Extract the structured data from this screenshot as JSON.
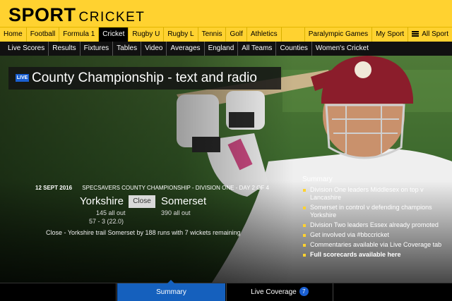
{
  "brand": {
    "sport": "SPORT",
    "section": "CRICKET"
  },
  "nav_primary": [
    "Home",
    "Football",
    "Formula 1",
    "Cricket",
    "Rugby U",
    "Rugby L",
    "Tennis",
    "Golf",
    "Athletics"
  ],
  "nav_primary_active": "Cricket",
  "nav_primary_right": [
    "Paralympic Games",
    "My Sport",
    "All Sport"
  ],
  "nav_secondary": [
    "Live Scores",
    "Results",
    "Fixtures",
    "Tables",
    "Video",
    "Averages",
    "England",
    "All Teams",
    "Counties",
    "Women's Cricket"
  ],
  "headline": {
    "badge": "LIVE",
    "title": "County Championship - text and radio"
  },
  "match": {
    "date": "12 SEPT 2016",
    "competition": "SPECSAVERS COUNTY CHAMPIONSHIP - DIVISION ONE - DAY 2 OF 4",
    "home_team": "Yorkshire",
    "away_team": "Somerset",
    "status": "Close",
    "home_score_1": "145 all out",
    "home_score_2": "57 - 3 (22.0)",
    "away_score_1": "390 all out",
    "summary": "Close - Yorkshire trail Somerset by 188 runs with 7 wickets remaining"
  },
  "summary": {
    "title": "Summary",
    "items": [
      "Division One leaders Middlesex on top v Lancashire",
      "Somerset in control v defending champions Yorkshire",
      "Division Two leaders Essex already promoted",
      "Get involved via #bbccricket",
      "Commentaries available via Live Coverage tab",
      "Full scorecards available here"
    ]
  },
  "tabs": {
    "summary": "Summary",
    "live": "Live Coverage",
    "live_count": "7"
  },
  "colors": {
    "brand_yellow": "#ffd230",
    "accent_blue": "#1560bd"
  }
}
